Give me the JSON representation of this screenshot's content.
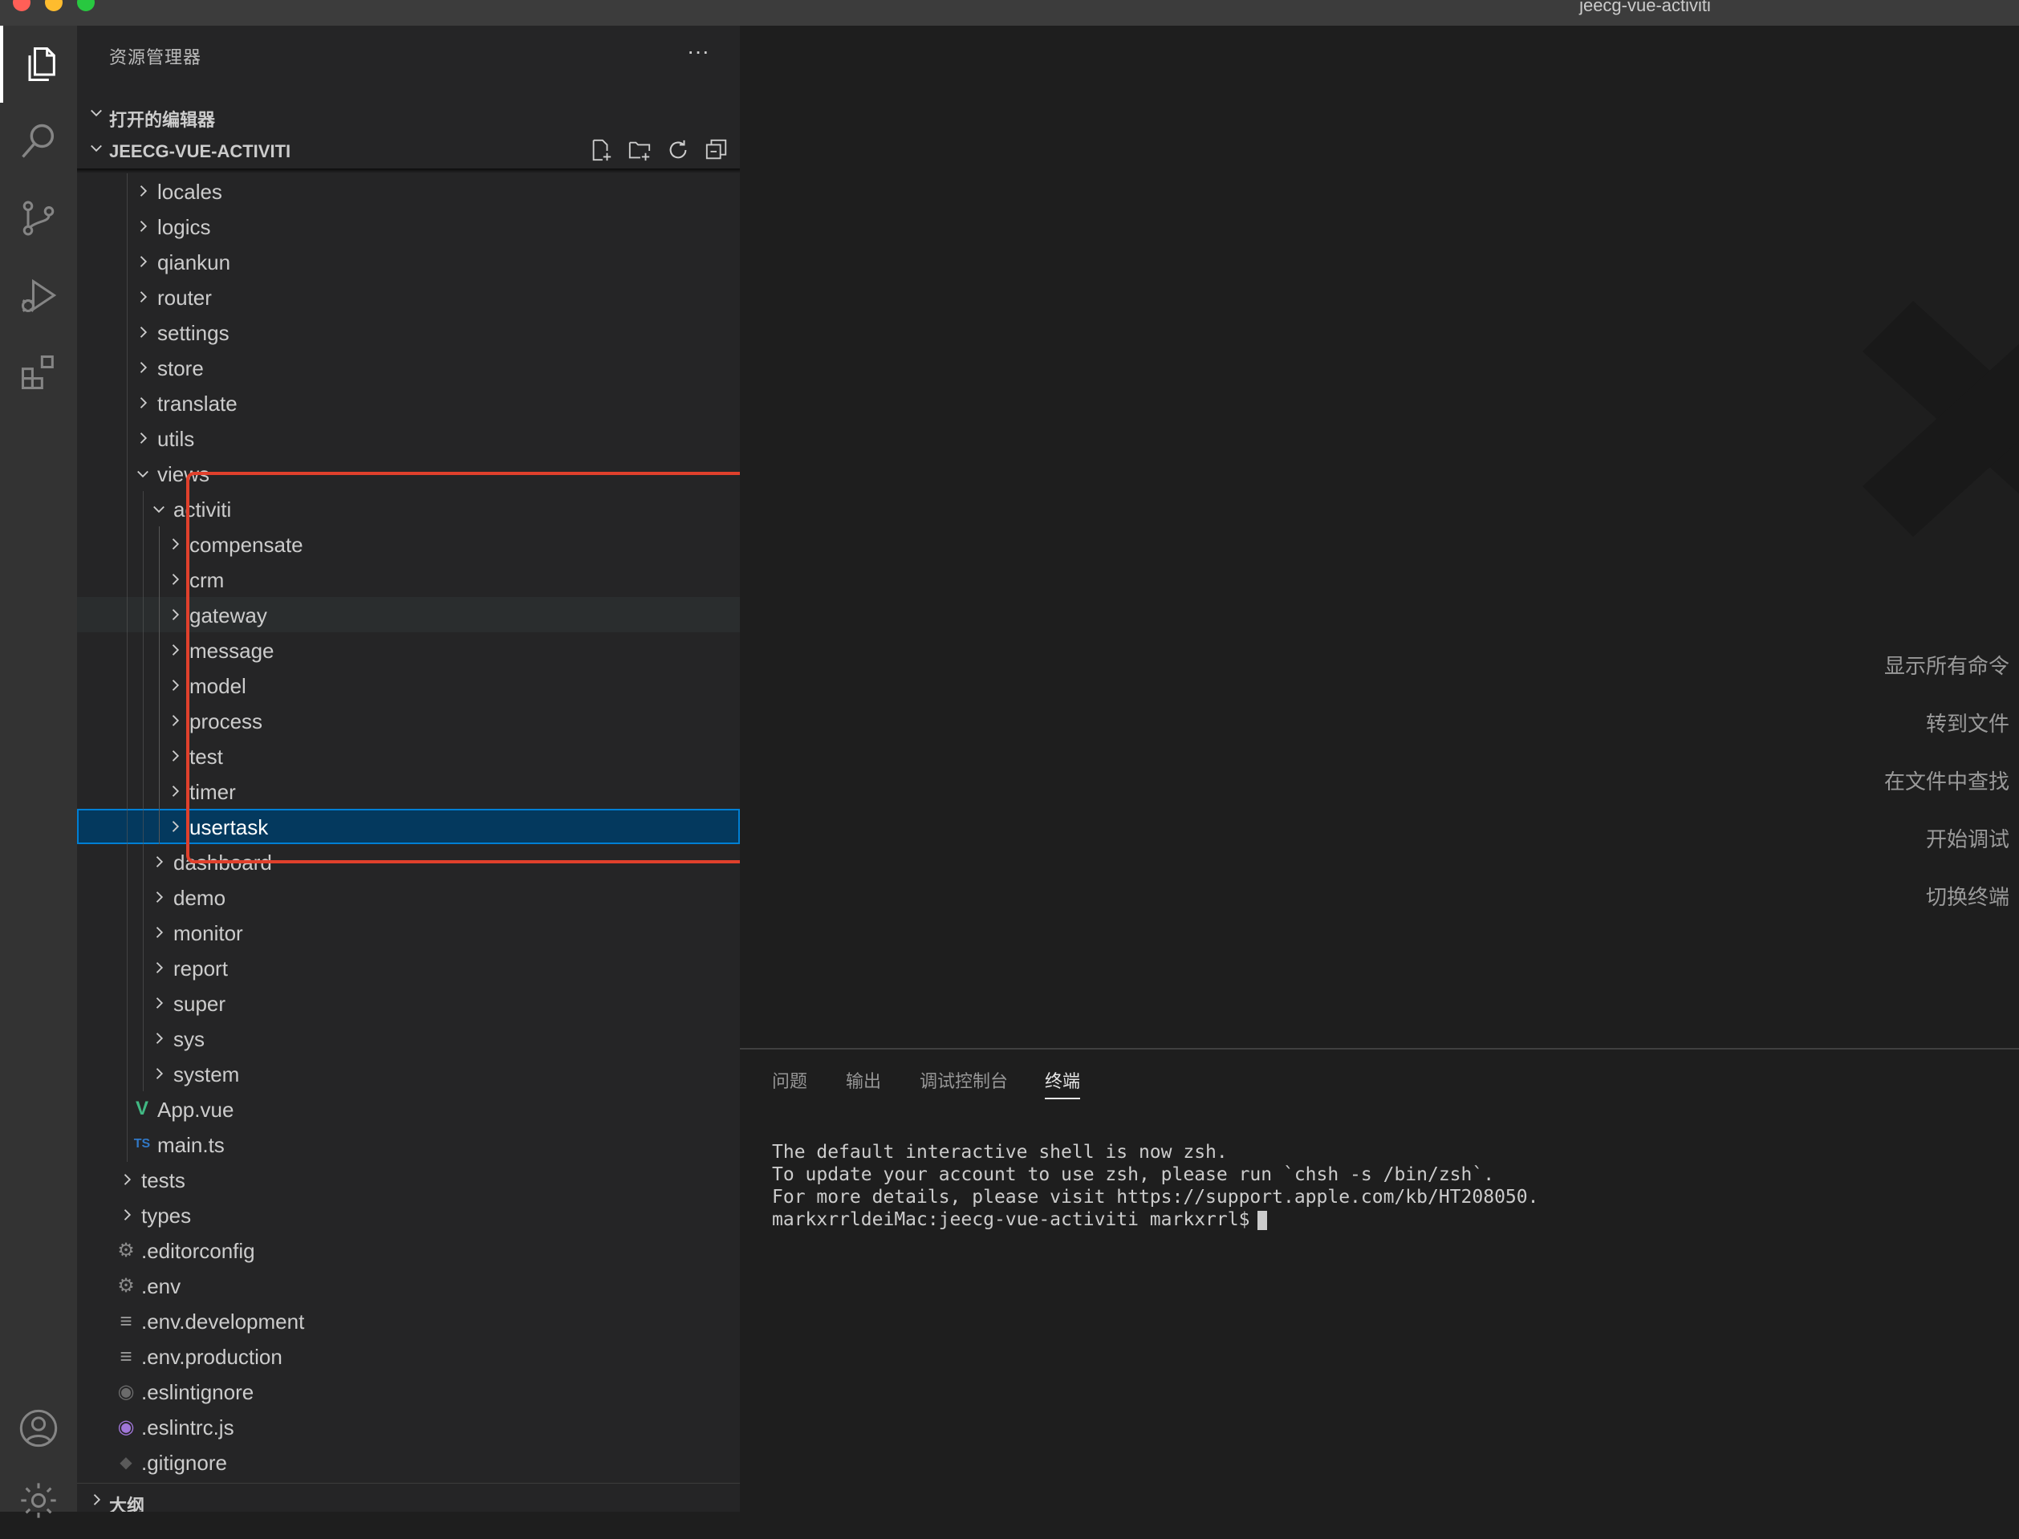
{
  "window": {
    "title": "jeecg-vue-activiti"
  },
  "activity_bar": {
    "items": [
      "explorer-icon",
      "search-icon",
      "source-control-icon",
      "run-debug-icon",
      "extensions-icon",
      "account-icon",
      "settings-gear-icon"
    ]
  },
  "sidebar": {
    "header": "资源管理器",
    "more": "···",
    "open_editors_label": "打开的编辑器",
    "root_label": "JEECG-VUE-ACTIVITI",
    "outline_label": "大纲",
    "tree": [
      {
        "label": "locales",
        "type": "folder",
        "depth": 2,
        "expanded": false
      },
      {
        "label": "logics",
        "type": "folder",
        "depth": 2,
        "expanded": false
      },
      {
        "label": "qiankun",
        "type": "folder",
        "depth": 2,
        "expanded": false
      },
      {
        "label": "router",
        "type": "folder",
        "depth": 2,
        "expanded": false
      },
      {
        "label": "settings",
        "type": "folder",
        "depth": 2,
        "expanded": false
      },
      {
        "label": "store",
        "type": "folder",
        "depth": 2,
        "expanded": false
      },
      {
        "label": "translate",
        "type": "folder",
        "depth": 2,
        "expanded": false
      },
      {
        "label": "utils",
        "type": "folder",
        "depth": 2,
        "expanded": false
      },
      {
        "label": "views",
        "type": "folder",
        "depth": 2,
        "expanded": true
      },
      {
        "label": "activiti",
        "type": "folder",
        "depth": 3,
        "expanded": true
      },
      {
        "label": "compensate",
        "type": "folder",
        "depth": 4,
        "expanded": false
      },
      {
        "label": "crm",
        "type": "folder",
        "depth": 4,
        "expanded": false
      },
      {
        "label": "gateway",
        "type": "folder",
        "depth": 4,
        "expanded": false,
        "hover": true
      },
      {
        "label": "message",
        "type": "folder",
        "depth": 4,
        "expanded": false
      },
      {
        "label": "model",
        "type": "folder",
        "depth": 4,
        "expanded": false
      },
      {
        "label": "process",
        "type": "folder",
        "depth": 4,
        "expanded": false
      },
      {
        "label": "test",
        "type": "folder",
        "depth": 4,
        "expanded": false
      },
      {
        "label": "timer",
        "type": "folder",
        "depth": 4,
        "expanded": false
      },
      {
        "label": "usertask",
        "type": "folder",
        "depth": 4,
        "expanded": false,
        "selected": true
      },
      {
        "label": "dashboard",
        "type": "folder",
        "depth": 3,
        "expanded": false
      },
      {
        "label": "demo",
        "type": "folder",
        "depth": 3,
        "expanded": false
      },
      {
        "label": "monitor",
        "type": "folder",
        "depth": 3,
        "expanded": false
      },
      {
        "label": "report",
        "type": "folder",
        "depth": 3,
        "expanded": false
      },
      {
        "label": "super",
        "type": "folder",
        "depth": 3,
        "expanded": false
      },
      {
        "label": "sys",
        "type": "folder",
        "depth": 3,
        "expanded": false
      },
      {
        "label": "system",
        "type": "folder",
        "depth": 3,
        "expanded": false
      },
      {
        "label": "App.vue",
        "type": "vue",
        "depth": 2
      },
      {
        "label": "main.ts",
        "type": "ts",
        "depth": 2
      },
      {
        "label": "tests",
        "type": "folder",
        "depth": 1,
        "expanded": false
      },
      {
        "label": "types",
        "type": "folder",
        "depth": 1,
        "expanded": false
      },
      {
        "label": ".editorconfig",
        "type": "gear",
        "depth": 1
      },
      {
        "label": ".env",
        "type": "gear",
        "depth": 1
      },
      {
        "label": ".env.development",
        "type": "lines",
        "depth": 1
      },
      {
        "label": ".env.production",
        "type": "lines",
        "depth": 1
      },
      {
        "label": ".eslintignore",
        "type": "eslint-gray",
        "depth": 1
      },
      {
        "label": ".eslintrc.js",
        "type": "eslint",
        "depth": 1
      },
      {
        "label": ".gitignore",
        "type": "git",
        "depth": 1
      }
    ]
  },
  "editor": {
    "commands": [
      "显示所有命令",
      "转到文件",
      "在文件中查找",
      "开始调试",
      "切换终端"
    ]
  },
  "panel": {
    "tabs": [
      {
        "label": "问题",
        "active": false
      },
      {
        "label": "输出",
        "active": false
      },
      {
        "label": "调试控制台",
        "active": false
      },
      {
        "label": "终端",
        "active": true
      }
    ],
    "terminal_lines": [
      "The default interactive shell is now zsh.",
      "To update your account to use zsh, please run `chsh -s /bin/zsh`.",
      "For more details, please visit https://support.apple.com/kb/HT208050.",
      "markxrrldeiMac:jeecg-vue-activiti markxrrl$"
    ]
  },
  "colors": {
    "accent": "#007fd4",
    "selection": "#04395e",
    "annotation": "#e0402c",
    "vue": "#41b883",
    "ts": "#3178c6",
    "eslint": "#a076d9"
  }
}
